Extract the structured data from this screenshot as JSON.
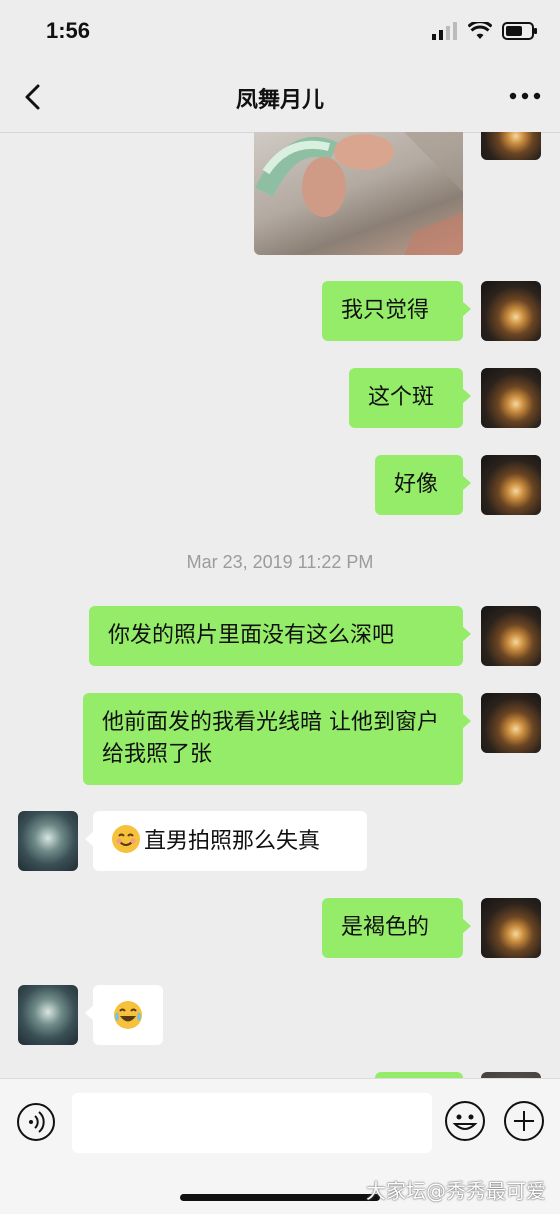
{
  "status_bar": {
    "time": "1:56"
  },
  "header": {
    "title": "凤舞月儿"
  },
  "chat": {
    "timestamp": "Mar 23, 2019 11:22 PM",
    "messages": [
      {
        "sender": "me",
        "text": "我只觉得"
      },
      {
        "sender": "me",
        "text": "这个斑"
      },
      {
        "sender": "me",
        "text": "好像"
      },
      {
        "sender": "me",
        "text": "你发的照片里面没有这么深吧"
      },
      {
        "sender": "me",
        "text": "他前面发的我看光线暗 让他到窗户给我照了张"
      },
      {
        "sender": "other",
        "text": "直男拍照那么失真",
        "emoji": "smiling-face-with-smiling-eyes"
      },
      {
        "sender": "me",
        "text": "是褐色的"
      },
      {
        "sender": "other",
        "text": "",
        "emoji": "face-with-tears-of-joy"
      }
    ]
  },
  "watermark": "大家坛@秀秀最可爱",
  "colors": {
    "my_bubble": "#95ec69",
    "other_bubble": "#ffffff",
    "background": "#ededed"
  }
}
